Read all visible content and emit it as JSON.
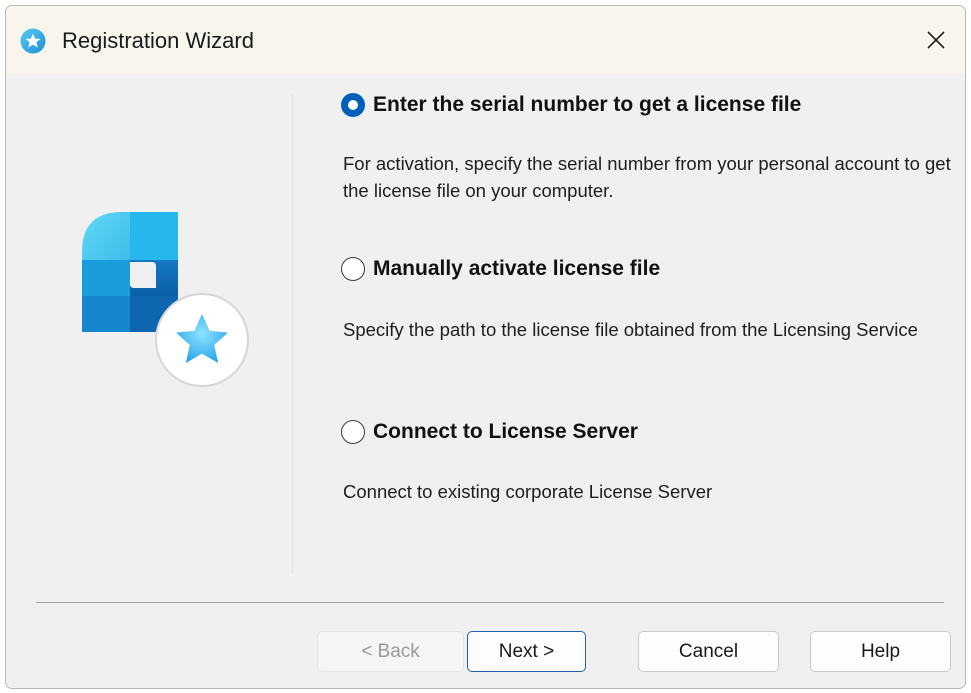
{
  "window": {
    "title": "Registration Wizard",
    "title_icon": "star-badge-icon",
    "close_icon": "close-icon"
  },
  "logo": {
    "icon": "license-star-logo"
  },
  "options": [
    {
      "label": "Enter the serial number to get a license file",
      "checked": true,
      "description": "For activation, specify the serial number from your personal account to get the license file on your computer."
    },
    {
      "label": "Manually activate license file",
      "checked": false,
      "description": "Specify the path to the license file obtained from the Licensing Service"
    },
    {
      "label": "Connect to License Server",
      "checked": false,
      "description": "Connect to existing corporate License Server"
    }
  ],
  "buttons": {
    "back": "< Back",
    "next": "Next >",
    "cancel": "Cancel",
    "help": "Help"
  },
  "colors": {
    "accent": "#005fb8",
    "titlebar": "#f7f5ec",
    "dialog_bg": "#f0f0f0"
  }
}
